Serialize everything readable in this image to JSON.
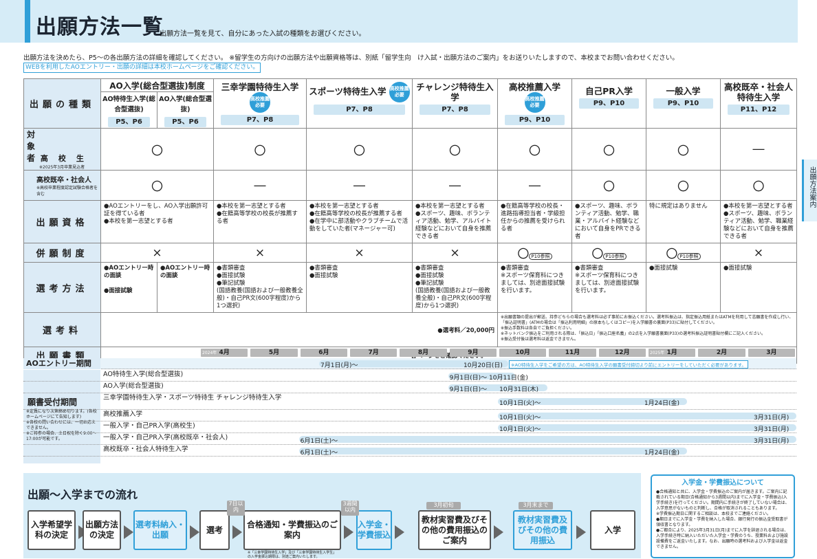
{
  "header": {
    "title": "出願方法一覧",
    "subtitle": "出願方法一覧を見て、自分にあった入試の種類をお選びください。"
  },
  "intro": {
    "line1": "出願方法を決めたら、P5〜の各出願方法の詳細を確認してください。 ※留学生の方向けの出願方法や出願資格等は、別紙「留学生向　け入試・出願方法のご案内」をお送りいたしますので、本校までお問い合わせください。",
    "web_link": "WEBを利用したAOエントリー・出願の詳細は本校ホームページをご確認ください。"
  },
  "side_tab": "出願方法案内",
  "table": {
    "row_headers": {
      "type": "出願の種類",
      "target": "対象者",
      "target_a": "高　校　生",
      "target_a_note": "※2025年3月卒業見込者",
      "target_b": "高校既卒・社会人",
      "target_b_note": "※高校卒業程度認定試験合格者を含む",
      "qualification": "出願資格",
      "combined": "併願制度",
      "method": "選考方法",
      "fee": "選考料",
      "documents": "出願書類"
    },
    "columns": [
      {
        "name": "AO入学(総合型選抜)制度",
        "sub1": "AO特待生入学(総合型選抜)",
        "sub2": "AO入学(総合型選抜)",
        "pages1": "P5、P6",
        "pages2": "P5、P6"
      },
      {
        "name": "三幸学園特待生入学",
        "badge": "高校推薦必要",
        "pages": "P7、P8"
      },
      {
        "name": "スポーツ特待生入学",
        "badge": "高校推薦必要",
        "pages": "P7、P8"
      },
      {
        "name": "チャレンジ特待生入学",
        "pages": "P7、P8"
      },
      {
        "name": "高校推薦入学",
        "badge": "高校推薦必要",
        "pages": "P9、P10"
      },
      {
        "name": "自己PR入学",
        "pages": "P9、P10"
      },
      {
        "name": "一般入学",
        "pages": "P9、P10"
      },
      {
        "name": "高校既卒・社会人特待生入学",
        "pages": "P11、P12"
      }
    ],
    "target_a": [
      "〇",
      "〇",
      "〇",
      "〇",
      "〇",
      "〇",
      "〇",
      "―"
    ],
    "target_b": [
      "〇",
      "―",
      "―",
      "―",
      "―",
      "〇",
      "〇",
      "〇"
    ],
    "qualification": [
      "●AOエントリーをし、AO入学出願許可証を得ている者\n●本校を第一志望とする者",
      "●本校を第一志望とする者\n●在籍高等学校の校長が推薦する者",
      "●本校を第一志望とする者\n●在籍高等学校の校長が推薦する者\n●在学中に部活動やクラブチームで活動をしていた者(マネージャー可)",
      "●本校を第一志望とする者\n●スポーツ、趣味、ボランティア活動、勉学、アルバイト経験などにおいて自身を推薦できる者",
      "●在籍高等学校の校長・進路指導担当者・学級担任からの推薦を受けられる者",
      "●スポーツ、趣味、ボランティア活動、勉学、職業・アルバイト経験などにおいて自身をPRできる者",
      "特に規定はありません",
      "●本校を第一志望とする者\n●スポーツ、趣味、ボランティア活動、勉学、職業経験などにおいて自身を推薦できる者"
    ],
    "combined": [
      "×",
      "×",
      "×",
      "×",
      "〇",
      "〇",
      "〇",
      "×"
    ],
    "combined_ref": "P10参照",
    "method": {
      "ao1": "●AOエントリー時の面談\n\n●面接試験",
      "ao2": "●AOエントリー時の面談",
      "c2": "●書類審査\n●面接試験\n●筆記試験\n(国語教養(国語および一般教養全般)・自己PR文(600字程度)から1つ選択)",
      "c3": "●書類審査\n●面接試験",
      "c4": "●書類審査\n●面接試験\n●筆記試験\n(国語教養(国語および一般教養全般)・自己PR文(600字程度)から1つ選択)",
      "c5": "●書類審査\n※スポーツ保育科につきましては、別途面接試験を行います。",
      "c6": "●書類審査\n※スポーツ保育科につきましては、別途面接試験を行います。",
      "c7": "●面接試験",
      "c8": "●面接試験"
    },
    "fee_amount": "●選考料／20,000円",
    "fee_notes": "※出願書類の提出が郵送、持参どちらの場合も選考料は必ず事前にお振込ください。選考料振込は、指定振込用紙またはATMを利用して志願書を作成し行い、「振込証明書」(ATMの場合は「振込利用明細」の原本もしくはコピー)を入学願書の裏面(P33)に貼付してください。\n※振込手数料は各自でご負担ください。\n※ネットバンク振込をご利用される際は、「振込日」「振込口座名義」の2点を入学願書裏面(P33)の選考料振込証明書貼付欄にご記入ください。\n※振込受付後は選考料は返金できません。",
    "documents": "各ページをご確認ください。"
  },
  "schedule": {
    "months": [
      "4月",
      "5月",
      "6月",
      "7月",
      "8月",
      "9月",
      "10月",
      "11月",
      "12月",
      "1月",
      "2月",
      "3月"
    ],
    "year1": "2024年",
    "year2": "2025年",
    "ao_entry": {
      "label": "AOエントリー期間",
      "text_start": "7月1日(月)〜",
      "text_end": "10月20日(日)",
      "note": "※AO特待生入学をご希望の方は、AO特待生入学の願書受付締切より前にエントリーをしていただく必要があります。"
    },
    "group_label": "願書受付期間",
    "group_notes": "※定員になり次第締め切ります。(各校ホームページにて告知します)\n※各校の問い合わせには、一切お応えできません。\n※ご持参の場合、土日祝を除く9:00〜17:00が可能です。",
    "rows": [
      {
        "label": "AO特待生入学(総合型選抜)",
        "text": "9月1日(日)〜 10月11日(金)",
        "start": 5.0,
        "end": 6.35
      },
      {
        "label": "AO入学(総合型選抜)",
        "text": "9月1日(日)〜　　10月31日(木)",
        "start": 5.0,
        "end": 7.0
      },
      {
        "label": "三幸学園特待生入学・スポーツ特待生 チャレンジ特待生入学",
        "text": "10月1日(火)〜",
        "end_text": "1月24日(金)",
        "start": 6.0,
        "end": 9.8
      },
      {
        "label": "高校推薦入学",
        "text": "10月1日(火)〜",
        "end_text": "3月31日(月)",
        "start": 6.0,
        "end": 12.0
      },
      {
        "label": "一般入学・自己PR入学(高校生)",
        "text": "10月1日(火)〜",
        "end_text": "3月31日(月)",
        "start": 6.0,
        "end": 12.0
      },
      {
        "label": "一般入学・自己PR入学(高校既卒・社会人)",
        "text": "6月1日(土)〜",
        "end_text": "3月31日(月)",
        "start": 2.0,
        "end": 12.0
      },
      {
        "label": "高校既卒・社会人特待生入学",
        "text": "6月1日(土)〜",
        "end_text": "1月24日(金)",
        "start": 2.0,
        "end": 9.8
      }
    ]
  },
  "flow": {
    "title": "出願〜入学までの流れ",
    "steps": [
      "入学希望学科の決定",
      "出願方法の決定",
      "選考料納入・出願",
      "選考",
      "合格通知・学費振込のご案内",
      "入学金・学費振込",
      "教材実習費及びその他の費用振込のご案内",
      "教材実習費及びその他の費用振込",
      "入学"
    ],
    "tags": [
      "7日以内",
      "3週間以内",
      "3月初旬",
      "3月末まで"
    ],
    "note": "※「三幸学園特待生入学」及び「三幸学園特待生入学生」の入学金振込期限は、別途ご案内いたします。"
  },
  "fee_box": {
    "title": "入学金・学費振込について",
    "text": "●合格通知と共に、入学金・学費振込のご案内が届きます。ご案内に記載されている期日(合格通知から3週間以内)までに入学金・学費振込(入学手続き)を行ってください。期間内に手続きが終了していない場合は、入学意思がないものと判断し、合格が取消されることもあります。\n※学費振込期日に関するご相談は、本校までご連絡ください。\n●期日までに入学金・学費を納入した場合、銀行発行の振込金受取書が領収書となります。\n●ご都合により、2025年3月31日(月)までに入学を辞退される場合は、入学手続き時に納入いただいた入学金・学費のうち、授業料および施設設備費をご返金いたします。なお、出願時の選考料および入学金は返金できません。"
  }
}
